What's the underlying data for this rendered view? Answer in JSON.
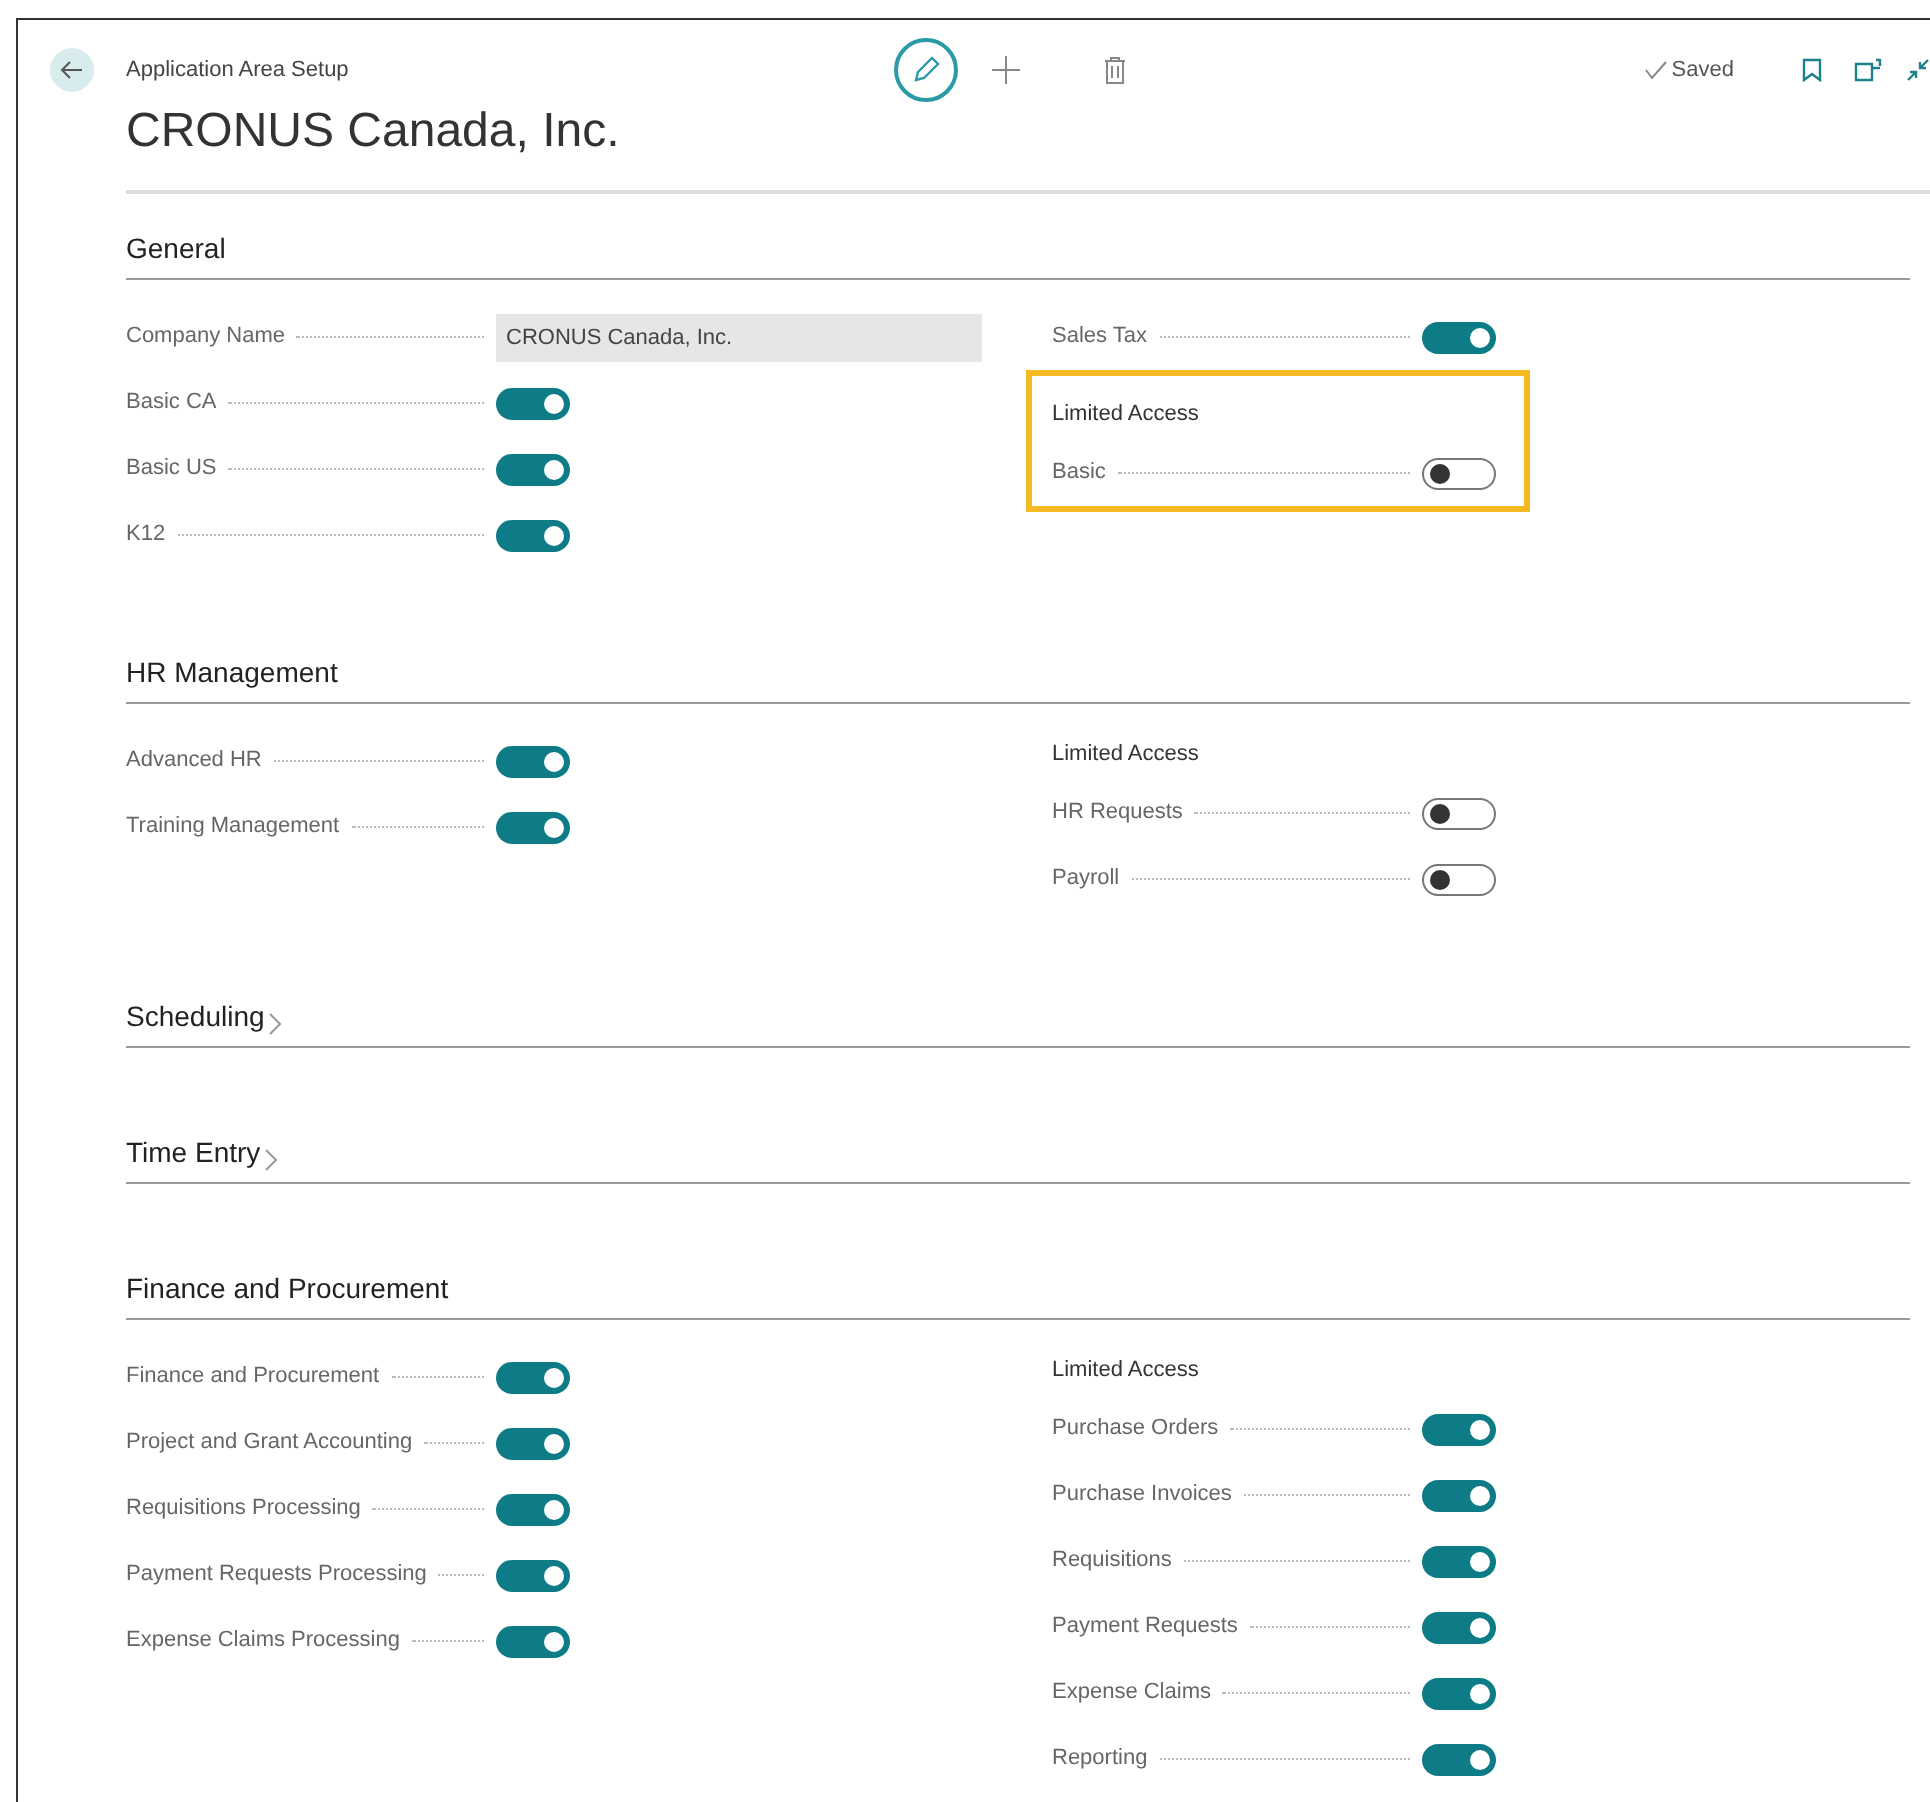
{
  "header": {
    "breadcrumb": "Application Area Setup",
    "title": "CRONUS Canada, Inc.",
    "status": "Saved"
  },
  "sections": [
    {
      "title": "General",
      "expanded": true,
      "left": [
        {
          "kind": "field",
          "label": "Company Name",
          "value": "CRONUS Canada, Inc."
        },
        {
          "kind": "toggle",
          "label": "Basic CA",
          "on": true
        },
        {
          "kind": "toggle",
          "label": "Basic US",
          "on": true
        },
        {
          "kind": "toggle",
          "label": "K12",
          "on": true
        }
      ],
      "right": [
        {
          "kind": "toggle",
          "label": "Sales Tax",
          "on": true
        },
        {
          "kind": "group",
          "title": "Limited Access",
          "highlighted": true,
          "items": [
            {
              "label": "Basic",
              "on": false
            }
          ]
        }
      ]
    },
    {
      "title": "HR Management",
      "expanded": true,
      "left": [
        {
          "kind": "toggle",
          "label": "Advanced HR",
          "on": true
        },
        {
          "kind": "toggle",
          "label": "Training Management",
          "on": true
        }
      ],
      "right": [
        {
          "kind": "group",
          "title": "Limited Access",
          "highlighted": false,
          "items": [
            {
              "label": "HR Requests",
              "on": false
            },
            {
              "label": "Payroll",
              "on": false
            }
          ]
        }
      ]
    },
    {
      "title": "Scheduling",
      "expanded": false
    },
    {
      "title": "Time Entry",
      "expanded": false
    },
    {
      "title": "Finance and Procurement",
      "expanded": true,
      "left": [
        {
          "kind": "toggle",
          "label": "Finance and Procurement",
          "on": true
        },
        {
          "kind": "toggle",
          "label": "Project and Grant Accounting",
          "on": true
        },
        {
          "kind": "toggle",
          "label": "Requisitions Processing",
          "on": true
        },
        {
          "kind": "toggle",
          "label": "Payment Requests Processing",
          "on": true
        },
        {
          "kind": "toggle",
          "label": "Expense Claims Processing",
          "on": true
        }
      ],
      "right": [
        {
          "kind": "group",
          "title": "Limited Access",
          "highlighted": false,
          "items": [
            {
              "label": "Purchase Orders",
              "on": true
            },
            {
              "label": "Purchase Invoices",
              "on": true
            },
            {
              "label": "Requisitions",
              "on": true
            },
            {
              "label": "Payment Requests",
              "on": true
            },
            {
              "label": "Expense Claims",
              "on": true
            },
            {
              "label": "Reporting",
              "on": true
            }
          ]
        }
      ]
    }
  ]
}
